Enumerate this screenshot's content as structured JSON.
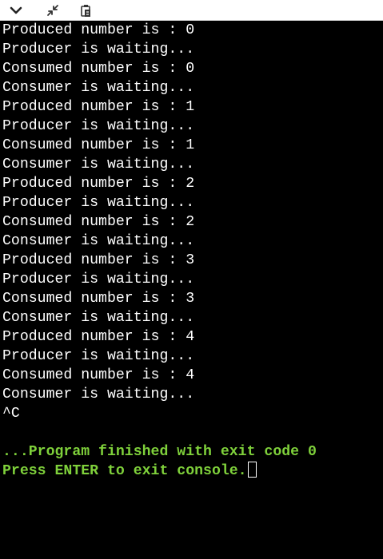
{
  "toolbar": {
    "buttons": [
      {
        "name": "chevron-down-icon"
      },
      {
        "name": "collapse-arrows-icon"
      },
      {
        "name": "copy-clipboard-icon"
      }
    ]
  },
  "console": {
    "lines": [
      "Produced number is : 0",
      "Producer is waiting...",
      "Consumed number is : 0",
      "Consumer is waiting...",
      "Produced number is : 1",
      "Producer is waiting...",
      "Consumed number is : 1",
      "Consumer is waiting...",
      "Produced number is : 2",
      "Producer is waiting...",
      "Consumed number is : 2",
      "Consumer is waiting...",
      "Produced number is : 3",
      "Producer is waiting...",
      "Consumed number is : 3",
      "Consumer is waiting...",
      "Produced number is : 4",
      "Producer is waiting...",
      "Consumed number is : 4",
      "Consumer is waiting...",
      "^C"
    ],
    "finish_message": "...Program finished with exit code 0",
    "exit_prompt": "Press ENTER to exit console.",
    "colors": {
      "background": "#000000",
      "text": "#ffffff",
      "status": "#7fd13b"
    }
  }
}
